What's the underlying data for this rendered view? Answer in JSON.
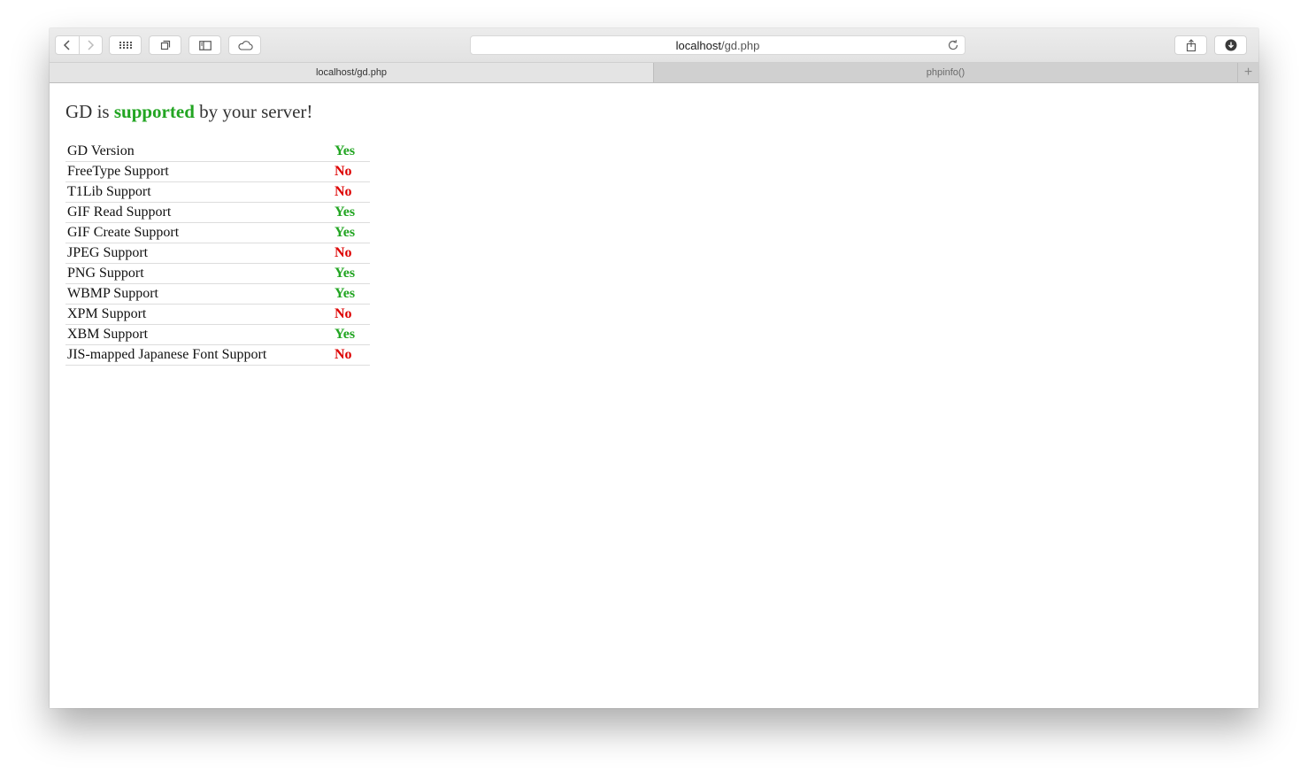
{
  "browser": {
    "address": {
      "host": "localhost",
      "path": "/gd.php"
    },
    "tabs": [
      {
        "label": "localhost/gd.php",
        "active": true
      },
      {
        "label": "phpinfo()",
        "active": false
      }
    ],
    "new_tab_label": "+"
  },
  "page": {
    "headline": {
      "prefix": "GD is",
      "highlight": "supported",
      "suffix": "by your server!"
    },
    "rows": [
      {
        "feature": "GD Version",
        "value": "Yes"
      },
      {
        "feature": "FreeType Support",
        "value": "No"
      },
      {
        "feature": "T1Lib Support",
        "value": "No"
      },
      {
        "feature": "GIF Read Support",
        "value": "Yes"
      },
      {
        "feature": "GIF Create Support",
        "value": "Yes"
      },
      {
        "feature": "JPEG Support",
        "value": "No"
      },
      {
        "feature": "PNG Support",
        "value": "Yes"
      },
      {
        "feature": "WBMP Support",
        "value": "Yes"
      },
      {
        "feature": "XPM Support",
        "value": "No"
      },
      {
        "feature": "XBM Support",
        "value": "Yes"
      },
      {
        "feature": "JIS-mapped Japanese Font Support",
        "value": "No"
      }
    ]
  },
  "colors": {
    "yes": "#22a522",
    "no": "#dd0000",
    "highlight": "#22a522"
  },
  "icons": {
    "back": "chevron-left-icon",
    "forward": "chevron-right-icon",
    "top_sites": "grid-icon",
    "tabs_overview": "tabs-icon",
    "sidebar": "sidebar-icon",
    "icloud_tabs": "cloud-icon",
    "reload": "reload-icon",
    "share": "share-icon",
    "downloads": "download-icon"
  }
}
